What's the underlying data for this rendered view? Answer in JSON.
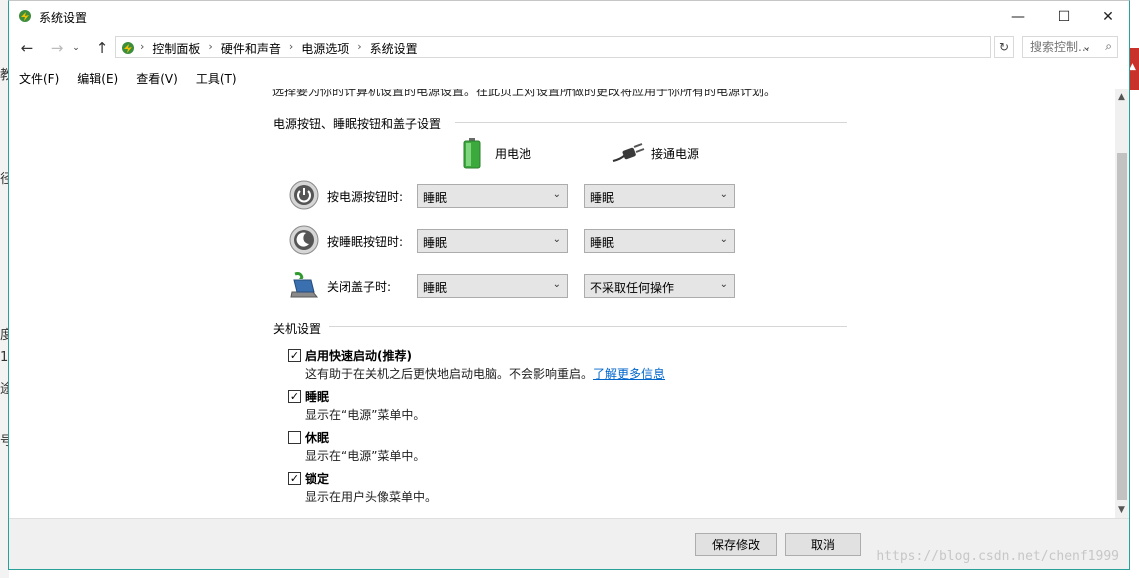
{
  "window": {
    "title": "系统设置",
    "controls": {
      "minimize": "—",
      "maximize": "☐",
      "close": "✕"
    }
  },
  "address": {
    "breadcrumbs": [
      "控制面板",
      "硬件和声音",
      "电源选项",
      "系统设置"
    ],
    "search_placeholder": "搜索控制..."
  },
  "menu": [
    "文件(F)",
    "编辑(E)",
    "查看(V)",
    "工具(T)"
  ],
  "intro_text_clipped": "选择要为你的计算机设置的电源设置。在此页上对设置所做的更改将应用于你所有的电源计划。",
  "power_section": {
    "title": "电源按钮、睡眠按钮和盖子设置",
    "columns": {
      "battery": "用电池",
      "plugged_in": "接通电源"
    },
    "rows": [
      {
        "label": "按电源按钮时:",
        "battery": "睡眠",
        "plugged_in": "睡眠",
        "icon": "power-button-icon"
      },
      {
        "label": "按睡眠按钮时:",
        "battery": "睡眠",
        "plugged_in": "睡眠",
        "icon": "sleep-button-icon"
      },
      {
        "label": "关闭盖子时:",
        "battery": "睡眠",
        "plugged_in": "不采取任何操作",
        "icon": "laptop-lid-icon"
      }
    ]
  },
  "shutdown_section": {
    "title": "关机设置",
    "options": [
      {
        "label": "启用快速启动(推荐)",
        "checked": true,
        "desc": "这有助于在关机之后更快地启动电脑。不会影响重启。",
        "link": "了解更多信息"
      },
      {
        "label": "睡眠",
        "checked": true,
        "desc": "显示在“电源”菜单中。"
      },
      {
        "label": "休眠",
        "checked": false,
        "desc": "显示在“电源”菜单中。"
      },
      {
        "label": "锁定",
        "checked": true,
        "desc": "显示在用户头像菜单中。"
      }
    ]
  },
  "footer": {
    "save": "保存修改",
    "cancel": "取消"
  },
  "watermark": "https://blog.csdn.net/chenf1999",
  "background_fragments": [
    "教",
    "径",
    "度",
    "1",
    "途",
    "号"
  ],
  "colors": {
    "window_border": "#2aa198",
    "link": "#0066cc",
    "button_face": "#e1e1e1",
    "select_face": "#e5e5e5"
  }
}
